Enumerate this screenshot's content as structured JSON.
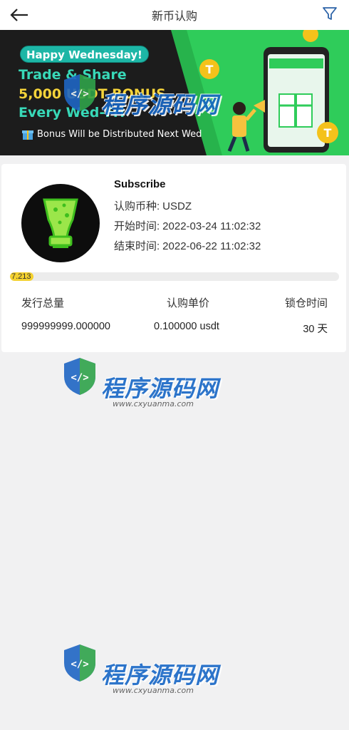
{
  "header": {
    "title": "新币认购",
    "back_icon": "arrow-left-icon",
    "filter_icon": "filter-icon"
  },
  "banner": {
    "greeting": "Happy Wednesday!",
    "line1": "Trade & Share",
    "line2": "5,000 USDT BONUS",
    "line3": "Every Wed-Fri",
    "bonus_note": "Bonus Will be Distributed Next Wed",
    "colors": {
      "background": "#222222",
      "accent_green": "#2ecc71",
      "accent_teal": "#1db6a6"
    }
  },
  "subscription": {
    "name": "Subscribe",
    "currency_label": "认购币种:",
    "currency_value": "USDZ",
    "start_label": "开始时间:",
    "start_value": "2022-03-24 11:02:32",
    "end_label": "结束时间:",
    "end_value": "2022-06-22 11:02:32",
    "progress_text": "7.213",
    "progress_percent": 7.213,
    "stats": {
      "total_label": "发行总量",
      "price_label": "认购单价",
      "lock_label": "锁仓时间",
      "total_value": "999999999.000000",
      "price_value": "0.100000 usdt",
      "lock_value": "30 天"
    }
  },
  "watermark": {
    "brand": "程序源码网",
    "url": "www.cxyuanma.com"
  }
}
